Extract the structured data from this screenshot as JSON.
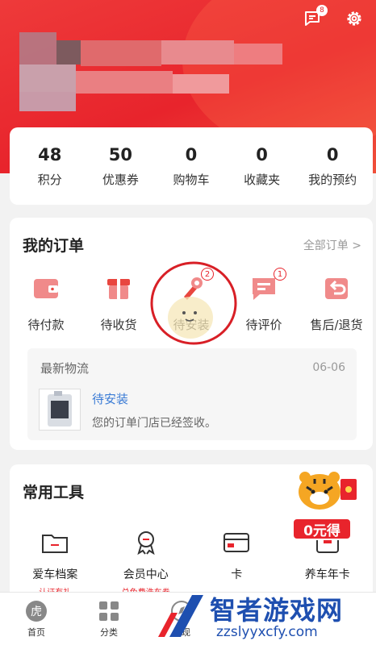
{
  "header": {
    "message_badge": "8"
  },
  "stats": [
    {
      "value": "48",
      "label": "积分"
    },
    {
      "value": "50",
      "label": "优惠券"
    },
    {
      "value": "0",
      "label": "购物车"
    },
    {
      "value": "0",
      "label": "收藏夹"
    },
    {
      "value": "0",
      "label": "我的预约"
    }
  ],
  "orders": {
    "title": "我的订单",
    "all_link": "全部订单 >",
    "items": [
      {
        "label": "待付款",
        "icon": "wallet-icon"
      },
      {
        "label": "待收货",
        "icon": "package-icon"
      },
      {
        "label": "待安装",
        "icon": "install-icon",
        "badge": "2"
      },
      {
        "label": "待评价",
        "icon": "comment-icon",
        "badge": "1"
      },
      {
        "label": "售后/退货",
        "icon": "return-icon"
      }
    ],
    "logistics": {
      "title": "最新物流",
      "date": "06-06",
      "status": "待安装",
      "description": "您的订单门店已经签收。"
    }
  },
  "tools": {
    "title": "常用工具",
    "items": [
      {
        "label": "爱车档案",
        "sub": "认证有礼",
        "icon": "folder-icon"
      },
      {
        "label": "会员中心",
        "sub": "兑免费洗车券",
        "icon": "medal-icon"
      },
      {
        "label": "卡",
        "sub": "",
        "icon": "card-icon"
      },
      {
        "label": "养车年卡",
        "sub": "",
        "icon": "annual-card-icon"
      }
    ],
    "promo": "0元得"
  },
  "tabbar": [
    {
      "label": "首页",
      "icon": "home-icon"
    },
    {
      "label": "分类",
      "icon": "grid-icon"
    },
    {
      "label": "发现",
      "icon": "discover-icon"
    }
  ],
  "watermark": {
    "title": "智者游戏网",
    "url": "zzslyyxcfy.com"
  },
  "colors": {
    "brand": "#e8242c",
    "link": "#3a7bd5"
  }
}
